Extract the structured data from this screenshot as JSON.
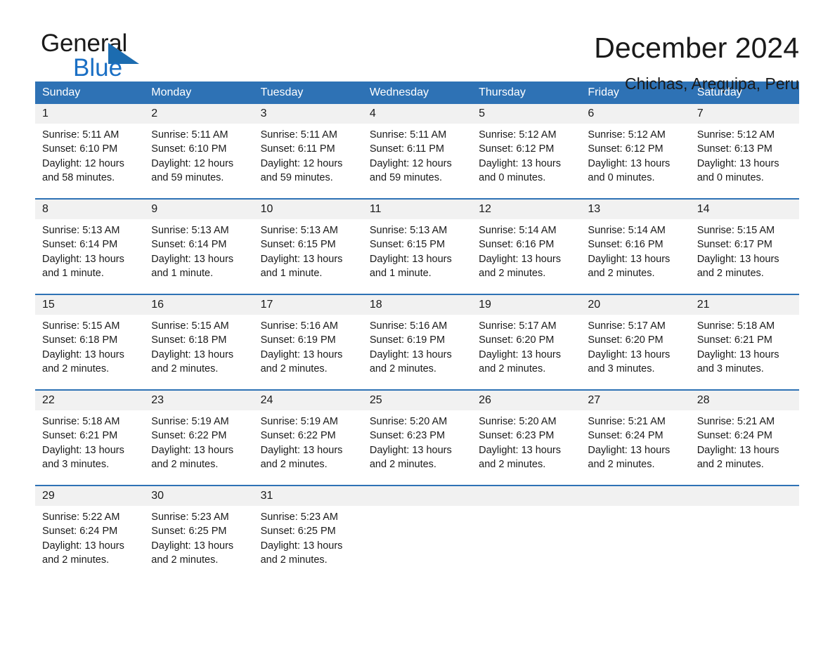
{
  "brand": {
    "word1": "General",
    "word2": "Blue",
    "triangle_color": "#1c6cb0",
    "blue_color": "#1a6fc4"
  },
  "header": {
    "title": "December 2024",
    "subtitle": "Chichas, Arequipa, Peru"
  },
  "theme": {
    "header_blue": "#2e72b5",
    "daynum_band": "#f1f1f1",
    "text": "#1a1a1a",
    "page_bg": "#ffffff"
  },
  "calendar": {
    "weekdays": [
      "Sunday",
      "Monday",
      "Tuesday",
      "Wednesday",
      "Thursday",
      "Friday",
      "Saturday"
    ],
    "weeks": [
      {
        "days": [
          {
            "num": "1",
            "sunrise": "Sunrise: 5:11 AM",
            "sunset": "Sunset: 6:10 PM",
            "daylight1": "Daylight: 12 hours",
            "daylight2": "and 58 minutes."
          },
          {
            "num": "2",
            "sunrise": "Sunrise: 5:11 AM",
            "sunset": "Sunset: 6:10 PM",
            "daylight1": "Daylight: 12 hours",
            "daylight2": "and 59 minutes."
          },
          {
            "num": "3",
            "sunrise": "Sunrise: 5:11 AM",
            "sunset": "Sunset: 6:11 PM",
            "daylight1": "Daylight: 12 hours",
            "daylight2": "and 59 minutes."
          },
          {
            "num": "4",
            "sunrise": "Sunrise: 5:11 AM",
            "sunset": "Sunset: 6:11 PM",
            "daylight1": "Daylight: 12 hours",
            "daylight2": "and 59 minutes."
          },
          {
            "num": "5",
            "sunrise": "Sunrise: 5:12 AM",
            "sunset": "Sunset: 6:12 PM",
            "daylight1": "Daylight: 13 hours",
            "daylight2": "and 0 minutes."
          },
          {
            "num": "6",
            "sunrise": "Sunrise: 5:12 AM",
            "sunset": "Sunset: 6:12 PM",
            "daylight1": "Daylight: 13 hours",
            "daylight2": "and 0 minutes."
          },
          {
            "num": "7",
            "sunrise": "Sunrise: 5:12 AM",
            "sunset": "Sunset: 6:13 PM",
            "daylight1": "Daylight: 13 hours",
            "daylight2": "and 0 minutes."
          }
        ]
      },
      {
        "days": [
          {
            "num": "8",
            "sunrise": "Sunrise: 5:13 AM",
            "sunset": "Sunset: 6:14 PM",
            "daylight1": "Daylight: 13 hours",
            "daylight2": "and 1 minute."
          },
          {
            "num": "9",
            "sunrise": "Sunrise: 5:13 AM",
            "sunset": "Sunset: 6:14 PM",
            "daylight1": "Daylight: 13 hours",
            "daylight2": "and 1 minute."
          },
          {
            "num": "10",
            "sunrise": "Sunrise: 5:13 AM",
            "sunset": "Sunset: 6:15 PM",
            "daylight1": "Daylight: 13 hours",
            "daylight2": "and 1 minute."
          },
          {
            "num": "11",
            "sunrise": "Sunrise: 5:13 AM",
            "sunset": "Sunset: 6:15 PM",
            "daylight1": "Daylight: 13 hours",
            "daylight2": "and 1 minute."
          },
          {
            "num": "12",
            "sunrise": "Sunrise: 5:14 AM",
            "sunset": "Sunset: 6:16 PM",
            "daylight1": "Daylight: 13 hours",
            "daylight2": "and 2 minutes."
          },
          {
            "num": "13",
            "sunrise": "Sunrise: 5:14 AM",
            "sunset": "Sunset: 6:16 PM",
            "daylight1": "Daylight: 13 hours",
            "daylight2": "and 2 minutes."
          },
          {
            "num": "14",
            "sunrise": "Sunrise: 5:15 AM",
            "sunset": "Sunset: 6:17 PM",
            "daylight1": "Daylight: 13 hours",
            "daylight2": "and 2 minutes."
          }
        ]
      },
      {
        "days": [
          {
            "num": "15",
            "sunrise": "Sunrise: 5:15 AM",
            "sunset": "Sunset: 6:18 PM",
            "daylight1": "Daylight: 13 hours",
            "daylight2": "and 2 minutes."
          },
          {
            "num": "16",
            "sunrise": "Sunrise: 5:15 AM",
            "sunset": "Sunset: 6:18 PM",
            "daylight1": "Daylight: 13 hours",
            "daylight2": "and 2 minutes."
          },
          {
            "num": "17",
            "sunrise": "Sunrise: 5:16 AM",
            "sunset": "Sunset: 6:19 PM",
            "daylight1": "Daylight: 13 hours",
            "daylight2": "and 2 minutes."
          },
          {
            "num": "18",
            "sunrise": "Sunrise: 5:16 AM",
            "sunset": "Sunset: 6:19 PM",
            "daylight1": "Daylight: 13 hours",
            "daylight2": "and 2 minutes."
          },
          {
            "num": "19",
            "sunrise": "Sunrise: 5:17 AM",
            "sunset": "Sunset: 6:20 PM",
            "daylight1": "Daylight: 13 hours",
            "daylight2": "and 2 minutes."
          },
          {
            "num": "20",
            "sunrise": "Sunrise: 5:17 AM",
            "sunset": "Sunset: 6:20 PM",
            "daylight1": "Daylight: 13 hours",
            "daylight2": "and 3 minutes."
          },
          {
            "num": "21",
            "sunrise": "Sunrise: 5:18 AM",
            "sunset": "Sunset: 6:21 PM",
            "daylight1": "Daylight: 13 hours",
            "daylight2": "and 3 minutes."
          }
        ]
      },
      {
        "days": [
          {
            "num": "22",
            "sunrise": "Sunrise: 5:18 AM",
            "sunset": "Sunset: 6:21 PM",
            "daylight1": "Daylight: 13 hours",
            "daylight2": "and 3 minutes."
          },
          {
            "num": "23",
            "sunrise": "Sunrise: 5:19 AM",
            "sunset": "Sunset: 6:22 PM",
            "daylight1": "Daylight: 13 hours",
            "daylight2": "and 2 minutes."
          },
          {
            "num": "24",
            "sunrise": "Sunrise: 5:19 AM",
            "sunset": "Sunset: 6:22 PM",
            "daylight1": "Daylight: 13 hours",
            "daylight2": "and 2 minutes."
          },
          {
            "num": "25",
            "sunrise": "Sunrise: 5:20 AM",
            "sunset": "Sunset: 6:23 PM",
            "daylight1": "Daylight: 13 hours",
            "daylight2": "and 2 minutes."
          },
          {
            "num": "26",
            "sunrise": "Sunrise: 5:20 AM",
            "sunset": "Sunset: 6:23 PM",
            "daylight1": "Daylight: 13 hours",
            "daylight2": "and 2 minutes."
          },
          {
            "num": "27",
            "sunrise": "Sunrise: 5:21 AM",
            "sunset": "Sunset: 6:24 PM",
            "daylight1": "Daylight: 13 hours",
            "daylight2": "and 2 minutes."
          },
          {
            "num": "28",
            "sunrise": "Sunrise: 5:21 AM",
            "sunset": "Sunset: 6:24 PM",
            "daylight1": "Daylight: 13 hours",
            "daylight2": "and 2 minutes."
          }
        ]
      },
      {
        "days": [
          {
            "num": "29",
            "sunrise": "Sunrise: 5:22 AM",
            "sunset": "Sunset: 6:24 PM",
            "daylight1": "Daylight: 13 hours",
            "daylight2": "and 2 minutes."
          },
          {
            "num": "30",
            "sunrise": "Sunrise: 5:23 AM",
            "sunset": "Sunset: 6:25 PM",
            "daylight1": "Daylight: 13 hours",
            "daylight2": "and 2 minutes."
          },
          {
            "num": "31",
            "sunrise": "Sunrise: 5:23 AM",
            "sunset": "Sunset: 6:25 PM",
            "daylight1": "Daylight: 13 hours",
            "daylight2": "and 2 minutes."
          },
          {
            "num": "",
            "sunrise": "",
            "sunset": "",
            "daylight1": "",
            "daylight2": ""
          },
          {
            "num": "",
            "sunrise": "",
            "sunset": "",
            "daylight1": "",
            "daylight2": ""
          },
          {
            "num": "",
            "sunrise": "",
            "sunset": "",
            "daylight1": "",
            "daylight2": ""
          },
          {
            "num": "",
            "sunrise": "",
            "sunset": "",
            "daylight1": "",
            "daylight2": ""
          }
        ]
      }
    ]
  }
}
